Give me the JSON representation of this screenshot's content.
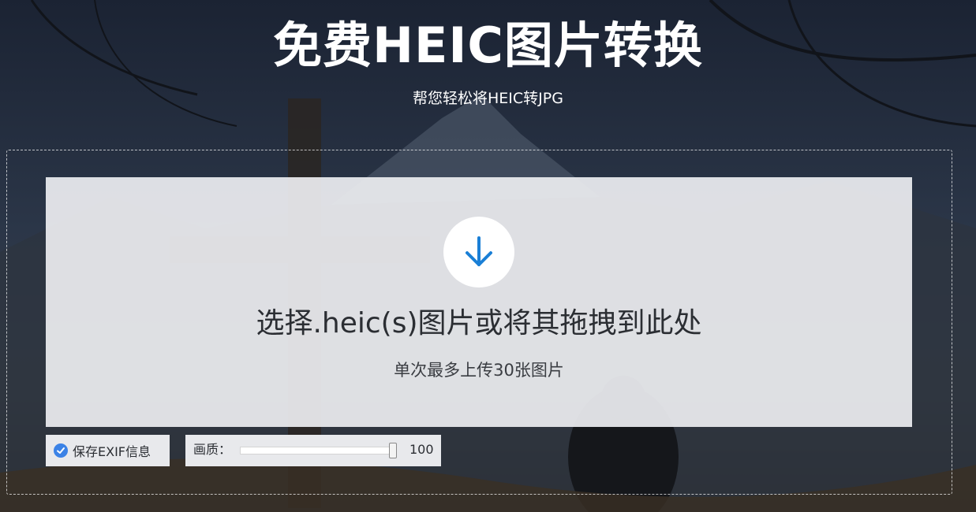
{
  "header": {
    "title": "免费HEIC图片转换",
    "subtitle": "帮您轻松将HEIC转JPG"
  },
  "dropzone": {
    "icon": "arrow-down-icon",
    "main_text": "选择.heic(s)图片或将其拖拽到此处",
    "sub_text": "单次最多上传30张图片"
  },
  "options": {
    "exif_label": "保存EXIF信息",
    "exif_checked": true,
    "quality_label": "画质：",
    "quality_value": "100",
    "quality_level": 1.0
  },
  "colors": {
    "accent": "#1a7fd6",
    "checkbox": "#3b82e6",
    "panel": "#eceef0"
  }
}
